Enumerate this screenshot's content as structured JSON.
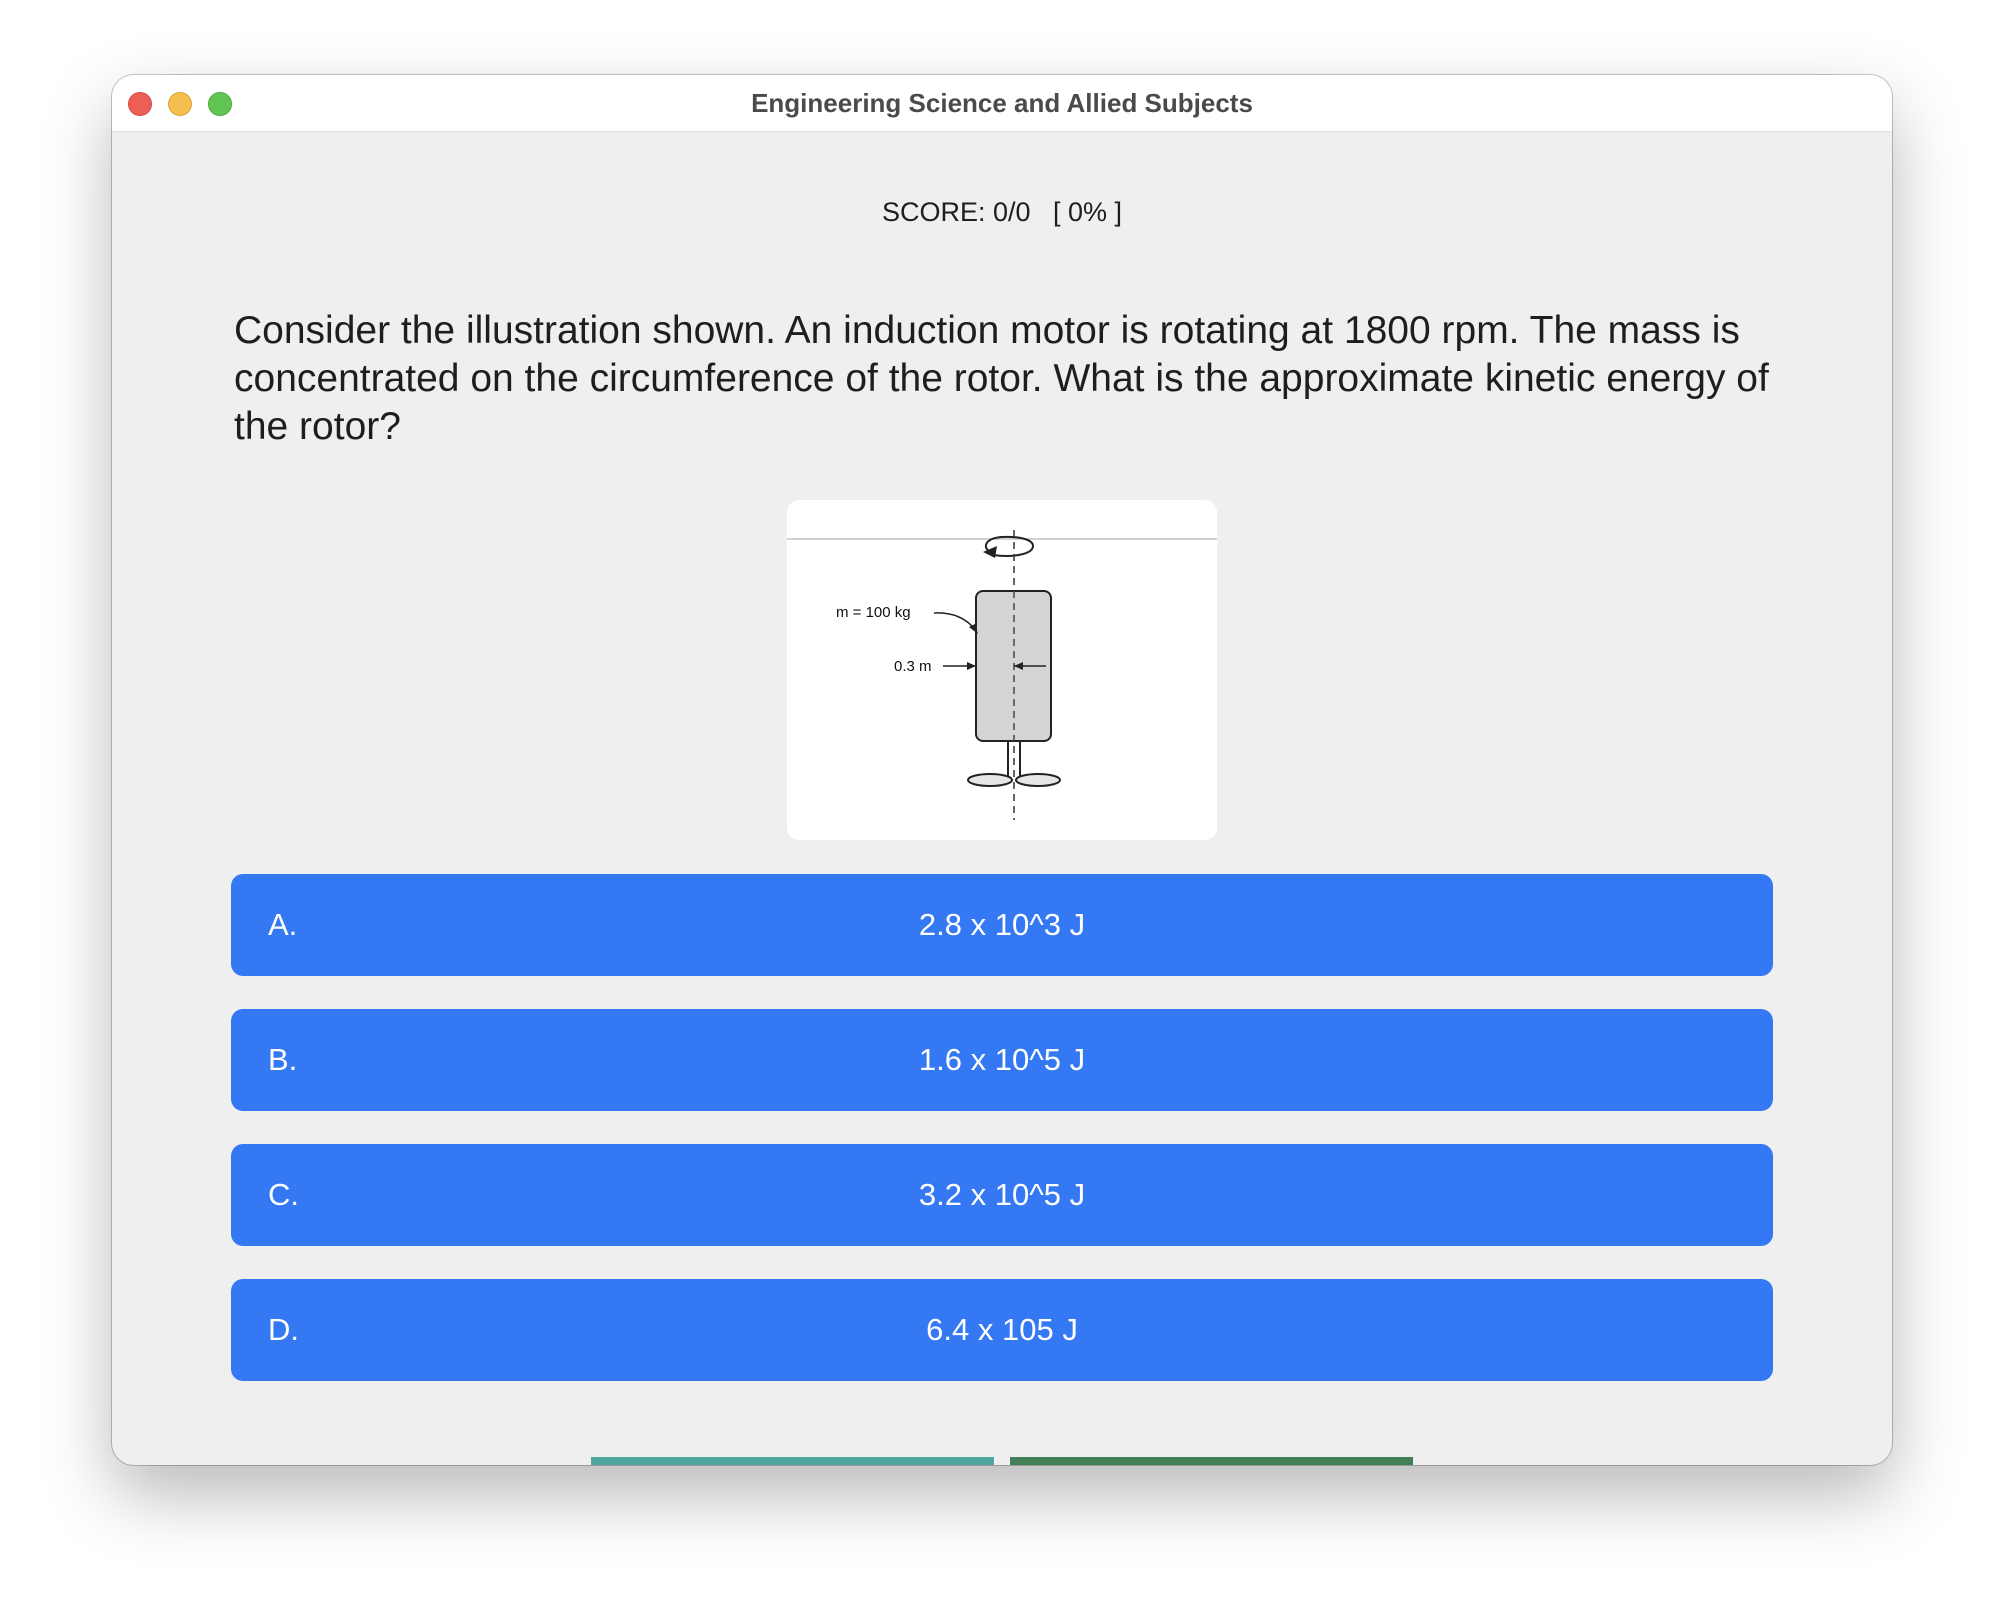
{
  "window": {
    "title": "Engineering Science and Allied Subjects"
  },
  "score": {
    "text": "SCORE: 0/0   [ 0% ]"
  },
  "question": {
    "text": "Consider the illustration shown. An induction motor is rotating at 1800 rpm. The mass is concentrated on the circumference of the rotor. What is the approximate kinetic energy of the rotor?"
  },
  "figure": {
    "mass_label": "m = 100 kg",
    "radius_label": "0.3 m"
  },
  "options": [
    {
      "letter": "A.",
      "text": "2.8 x 10^3 J"
    },
    {
      "letter": "B.",
      "text": "1.6 x 10^5 J"
    },
    {
      "letter": "C.",
      "text": "3.2 x 10^5 J"
    },
    {
      "letter": "D.",
      "text": "6.4 x 105 J"
    }
  ],
  "colors": {
    "option_background": "#3478f3",
    "bottom_button_1": "#4fa79f",
    "bottom_button_2": "#427f57",
    "window_background": "#efefef"
  }
}
